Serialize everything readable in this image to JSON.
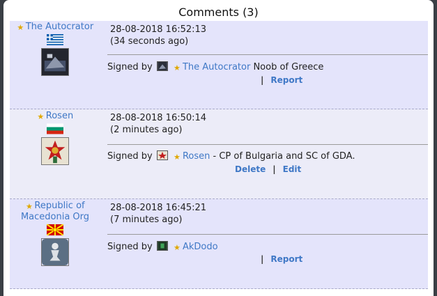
{
  "header": {
    "title": "Comments (3)"
  },
  "comments": [
    {
      "author": "The Autocrator",
      "timestamp": "28-08-2018 16:52:13",
      "relative": "(34 seconds ago)",
      "signed_label": "Signed by",
      "signer": "The Autocrator",
      "message": " Noob of Greece",
      "actions": [
        "Report"
      ]
    },
    {
      "author": "Rosen",
      "timestamp": "28-08-2018 16:50:14",
      "relative": "(2 minutes ago)",
      "signed_label": "Signed by",
      "signer": "Rosen",
      "message": " - CP of Bulgaria and SC of GDA.",
      "actions": [
        "Delete",
        "Edit"
      ]
    },
    {
      "author_line1": "Republic of",
      "author_line2": "Macedonia Org",
      "timestamp": "28-08-2018 16:45:21",
      "relative": "(7 minutes ago)",
      "signed_label": "Signed by",
      "signer": "AkDodo",
      "message": "",
      "actions": [
        "Report"
      ]
    }
  ],
  "colors": {
    "link": "#3f78c6",
    "row_bg": "#e4e4fb",
    "row_bg_alt": "#ececf8",
    "star": "#e0a800"
  },
  "icons": {
    "rank": "star-icon",
    "flags": [
      "greece-flag-icon",
      "bulgaria-flag-icon",
      "macedonia-flag-icon"
    ]
  }
}
